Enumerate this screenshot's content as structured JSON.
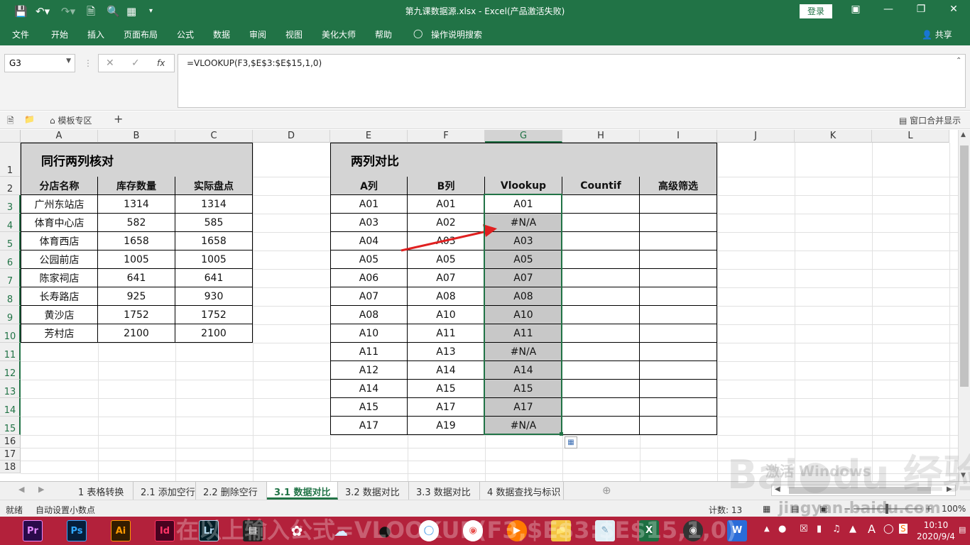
{
  "window": {
    "title": "第九课数据源.xlsx  -  Excel(产品激活失败)",
    "login": "登录",
    "share": "共享"
  },
  "ribbon_tabs": [
    "文件",
    "开始",
    "插入",
    "页面布局",
    "公式",
    "数据",
    "审阅",
    "视图",
    "美化大师",
    "帮助",
    "操作说明搜索"
  ],
  "formula_bar": {
    "name_box": "G3",
    "fx": "fx",
    "formula": "=VLOOKUP(F3,$E$3:$E$15,1,0)"
  },
  "template_bar": {
    "template_tab": "模板专区",
    "window_merge": "窗口合并显示"
  },
  "columns": [
    "A",
    "B",
    "C",
    "D",
    "E",
    "F",
    "G",
    "H",
    "I",
    "J",
    "K",
    "L"
  ],
  "rows": [
    "1",
    "2",
    "3",
    "4",
    "5",
    "6",
    "7",
    "8",
    "9",
    "10",
    "11",
    "12",
    "13",
    "14",
    "15",
    "16",
    "17",
    "18"
  ],
  "table1": {
    "title": "同行两列核对",
    "headers": [
      "分店名称",
      "库存数量",
      "实际盘点"
    ],
    "rows": [
      [
        "广州东站店",
        "1314",
        "1314"
      ],
      [
        "体育中心店",
        "582",
        "585"
      ],
      [
        "体育西店",
        "1658",
        "1658"
      ],
      [
        "公园前店",
        "1005",
        "1005"
      ],
      [
        "陈家祠店",
        "641",
        "641"
      ],
      [
        "长寿路店",
        "925",
        "930"
      ],
      [
        "黄沙店",
        "1752",
        "1752"
      ],
      [
        "芳村店",
        "2100",
        "2100"
      ]
    ]
  },
  "table2": {
    "title": "两列对比",
    "headers": [
      "A列",
      "B列",
      "Vlookup",
      "Countif",
      "高级筛选"
    ],
    "rows": [
      [
        "A01",
        "A01",
        "A01",
        "",
        ""
      ],
      [
        "A03",
        "A02",
        "#N/A",
        "",
        ""
      ],
      [
        "A04",
        "A03",
        "A03",
        "",
        ""
      ],
      [
        "A05",
        "A05",
        "A05",
        "",
        ""
      ],
      [
        "A06",
        "A07",
        "A07",
        "",
        ""
      ],
      [
        "A07",
        "A08",
        "A08",
        "",
        ""
      ],
      [
        "A08",
        "A10",
        "A10",
        "",
        ""
      ],
      [
        "A10",
        "A11",
        "A11",
        "",
        ""
      ],
      [
        "A11",
        "A13",
        "#N/A",
        "",
        ""
      ],
      [
        "A12",
        "A14",
        "A14",
        "",
        ""
      ],
      [
        "A14",
        "A15",
        "A15",
        "",
        ""
      ],
      [
        "A15",
        "A17",
        "A17",
        "",
        ""
      ],
      [
        "A17",
        "A19",
        "#N/A",
        "",
        ""
      ]
    ]
  },
  "sheet_tabs": [
    "1 表格转换",
    "2.1 添加空行",
    "2.2 删除空行",
    "3.1 数据对比",
    "3.2 数据对比",
    "3.3 数据对比",
    "4 数据查找与标识"
  ],
  "active_sheet": "3.1 数据对比",
  "status": {
    "ready": "就绪",
    "auto_decimal": "自动设置小数点",
    "count": "计数: 13",
    "zoom": "100%"
  },
  "taskbar": {
    "apps": [
      "Pr",
      "Ps",
      "Ai",
      "Id",
      "Lr"
    ],
    "time": "10:10",
    "date": "2020/9/4"
  },
  "watermark": {
    "text1": "在以上输入公式=VLOOKUP(F3,$E$3:$E$15,1,0)",
    "text2": "jingyan.baidu.com",
    "text3": "激活 Windows"
  },
  "colors": {
    "excel_green": "#217346",
    "header_gray": "#d4d4d4",
    "selected_gray": "#c8c8c8",
    "arrow_red": "#e02020",
    "taskbar": "#b3213b"
  }
}
